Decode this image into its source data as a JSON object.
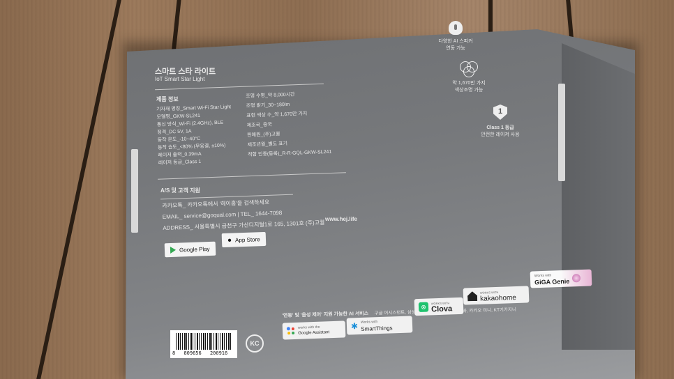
{
  "product": {
    "title_ko": "스마트 스타 라이트",
    "title_en": "IoT Smart Star Light"
  },
  "specs": {
    "heading": "제품 정보",
    "left": [
      "기자재 명칭_Smart Wi-Fi Star Light",
      "모델명_GKW-SL241",
      "통신 방식_Wi-Fi (2.4GHz), BLE",
      "정격_DC 5V, 1A",
      "동작 온도_-10~40°C",
      "동작 습도_<80% (무응결, ±10%)",
      "레이저 출력_0.39mA",
      "레이저 등급_Class 1"
    ],
    "right": [
      "조명 수명_약 8,000시간",
      "조명 밝기_30~180lm",
      "표현 색상 수_약 1,670만 가지",
      "제조국_중국",
      "판매원_(주)고퀄",
      "제조년월_별도 표기",
      "적합 인증(등록)_R-R-GQL-GKW-SL241"
    ]
  },
  "support": {
    "heading": "A/S 및 고객 지원",
    "lines": [
      "카카오톡_ 카카오톡에서 '헤이홈'을 검색하세요",
      "EMAIL_ service@goqual.com | TEL_ 1644-7098",
      "ADDRESS_ 서울특별시 금천구 가산디지털1로 165, 1301호 (주)고퀄"
    ],
    "website": "www.hej.life"
  },
  "stores": {
    "google_play": "Google Play",
    "app_store": "App Store"
  },
  "features": [
    {
      "icon": "microphone-icon",
      "line1": "다양한 AI 스피커",
      "line2": "연동 가능"
    },
    {
      "icon": "color-circles-icon",
      "line1": "약 1,670만 가지",
      "line2": "색상조명 가능"
    },
    {
      "icon": "shield-class1-icon",
      "badge": "1",
      "line1": "Class 1 등급",
      "line2": "안전한 레이저 사용"
    }
  ],
  "works_with": {
    "heading": "'연동' 및 '음성 제어' 지원 가능한 AI 서비스",
    "subtext": "구글 어시스턴트, 삼성 스마트싱스, 네이버 클로바, 카카오 미니, KT기가지니",
    "badges": [
      {
        "icon": "google-assistant-icon",
        "small": "works with the",
        "label": "Google Assistant"
      },
      {
        "icon": "smartthings-icon",
        "small": "Works with",
        "label": "SmartThings"
      },
      {
        "icon": "clova-icon",
        "small": "WORKS WITH",
        "label": "Clova"
      },
      {
        "icon": "kakao-home-icon",
        "small": "WORKS WITH",
        "label": "kakaohome"
      },
      {
        "icon": "giga-genie-icon",
        "small": "Works with",
        "label": "GiGA Genie"
      }
    ]
  },
  "barcode": {
    "digits_left": "8",
    "digits_mid": "809656",
    "digits_right": "200916"
  },
  "cert_mark": "KC",
  "colors": {
    "box_gray": "#76787b",
    "text_light": "#e8e8e8",
    "wood": "#9c7a5c"
  }
}
